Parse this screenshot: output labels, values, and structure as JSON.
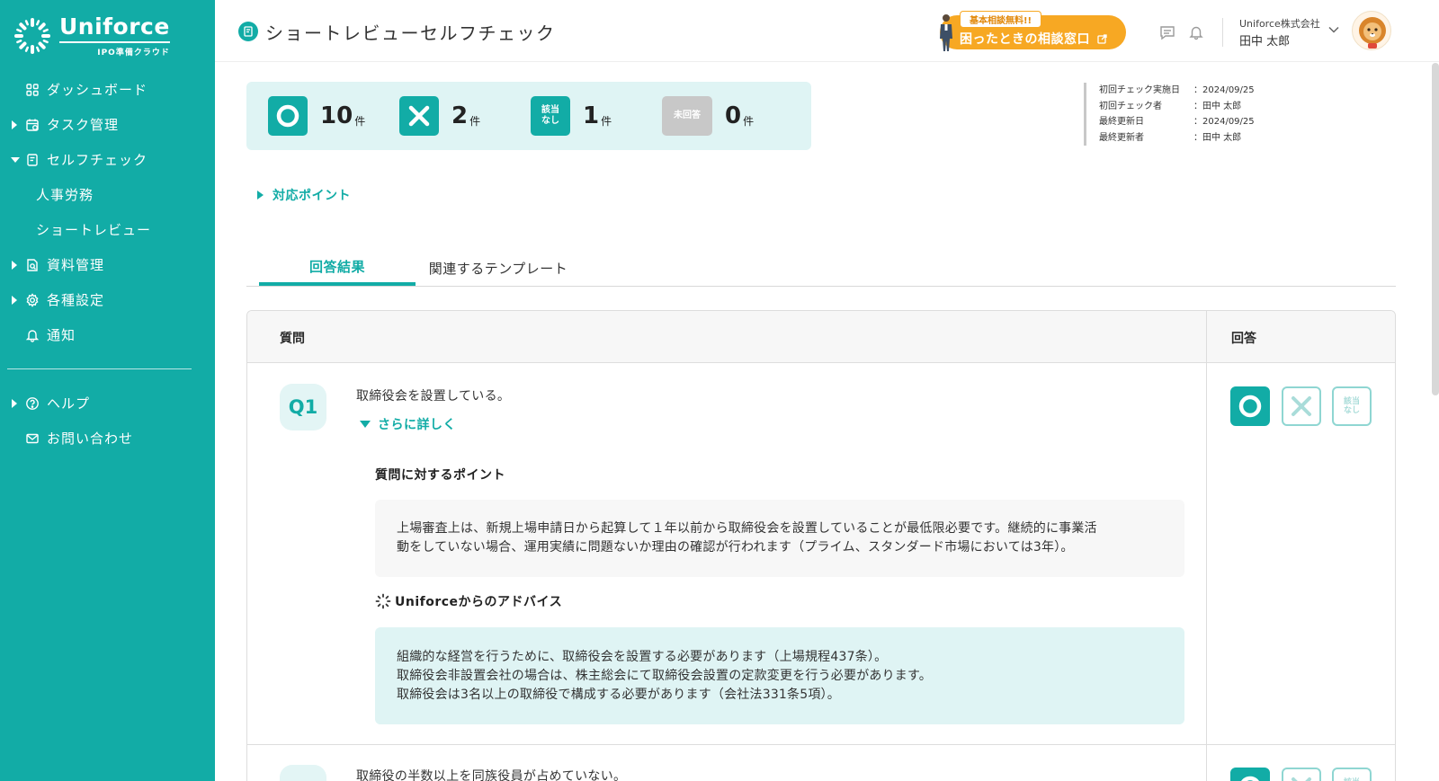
{
  "brand": {
    "name": "Uniforce",
    "tagline": "IPO準備クラウド",
    "color": "#12aca6"
  },
  "sidebar": {
    "items": [
      {
        "label": "ダッシュボード",
        "icon": "grid-icon"
      },
      {
        "label": "タスク管理",
        "icon": "calendar-icon"
      },
      {
        "label": "セルフチェック",
        "icon": "checklist-icon"
      },
      {
        "label": "人事労務"
      },
      {
        "label": "ショートレビュー"
      },
      {
        "label": "資料管理",
        "icon": "document-search-icon"
      },
      {
        "label": "各種設定",
        "icon": "gear-icon"
      },
      {
        "label": "通知",
        "icon": "bell-icon"
      },
      {
        "label": "ヘルプ",
        "icon": "help-icon"
      },
      {
        "label": "お問い合わせ",
        "icon": "mail-icon"
      }
    ]
  },
  "header": {
    "title": "ショートレビューセルフチェック",
    "consult_badge": "基本相談無料!!",
    "consult_label": "困ったときの相談窓口",
    "company": "Uniforce株式会社",
    "user": "田中 太郎"
  },
  "summary": {
    "ok_count": "10",
    "ng_count": "2",
    "na_label": "該当なし",
    "na_count": "1",
    "unanswered_label": "未回答",
    "unanswered_count": "0",
    "unit": "件"
  },
  "meta": [
    {
      "key": "初回チェック実施日",
      "value": "：2024/09/25"
    },
    {
      "key": "初回チェック者",
      "value": "：田中 太郎"
    },
    {
      "key": "最終更新日",
      "value": "：2024/09/25"
    },
    {
      "key": "最終更新者",
      "value": "：田中 太郎"
    }
  ],
  "points_label": "対応ポイント",
  "tabs": {
    "results": "回答結果",
    "templates": "関連するテンプレート"
  },
  "table": {
    "question_header": "質問",
    "answer_header": "回答"
  },
  "questions": [
    {
      "no": "Q1",
      "text": "取締役会を設置している。",
      "more": "さらに詳しく",
      "point_title": "質問に対するポイント",
      "point_lines": [
        "上場審査上は、新規上場申請日から起算して１年以前から取締役会を設置していることが最低限必要です。継続的に事業活",
        "動をしていない場合、運用実績に問題ないか理由の確認が行われます（プライム、スタンダード市場においては3年）。"
      ],
      "advice_title": "Uniforceからのアドバイス",
      "advice_lines": [
        "組織的な経営を行うために、取締役会を設置する必要があります（上場規程437条）。",
        "取締役会非設置会社の場合は、株主総会にて取締役会設置の定款変更を行う必要があります。",
        "取締役会は3名以上の取締役で構成する必要があります（会社法331条5項）。"
      ]
    },
    {
      "text": "取締役の半数以上を同族役員が占めていない。"
    }
  ],
  "answer_na_label": "該当なし"
}
